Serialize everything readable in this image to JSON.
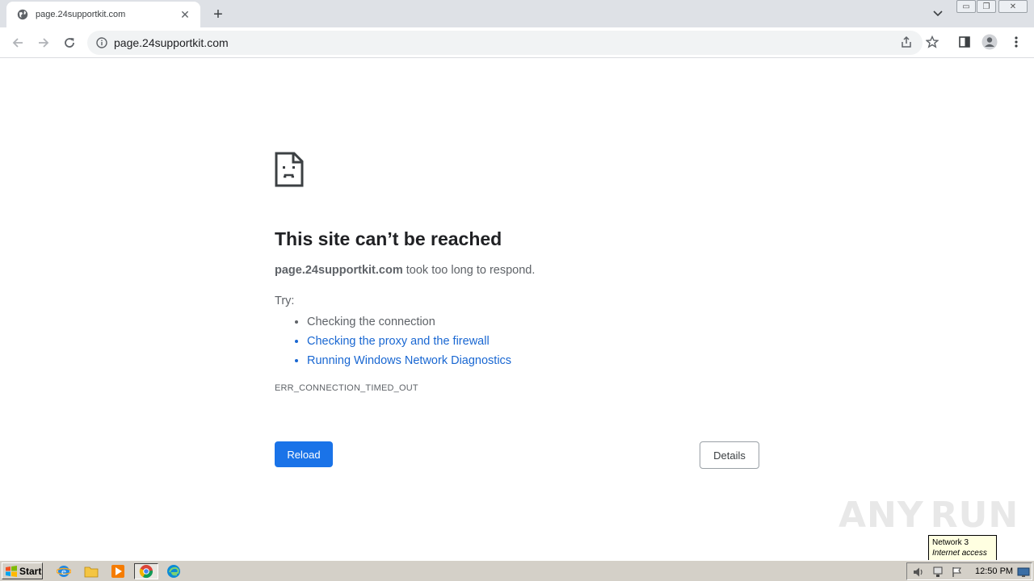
{
  "browser": {
    "tab": {
      "title": "page.24supportkit.com",
      "favicon": "globe-icon",
      "close_glyph": "✕"
    },
    "newtab_glyph": "+",
    "window_controls": {
      "minimize": "▭",
      "restore": "❐",
      "close": "✕"
    },
    "omnibox": {
      "url": "page.24supportkit.com",
      "security_icon": "info-icon"
    }
  },
  "error_page": {
    "title": "This site can’t be reached",
    "host": "page.24supportkit.com",
    "message": " took too long to respond.",
    "try_label": "Try:",
    "suggestions": [
      {
        "text": "Checking the connection"
      },
      {
        "text": "Checking the proxy and the firewall"
      },
      {
        "text": "Running Windows Network Diagnostics"
      }
    ],
    "error_code": "ERR_CONNECTION_TIMED_OUT",
    "reload_label": "Reload",
    "details_label": "Details"
  },
  "watermark": {
    "left": "ANY",
    "right": "RUN"
  },
  "tooltip": {
    "line1": "Network  3",
    "line2": "Internet access"
  },
  "taskbar": {
    "start_label": "Start",
    "clock": "12:50 PM"
  },
  "colors": {
    "accent": "#1a73e8",
    "link": "#1967d2",
    "taskbar": "#d4d0c8"
  }
}
